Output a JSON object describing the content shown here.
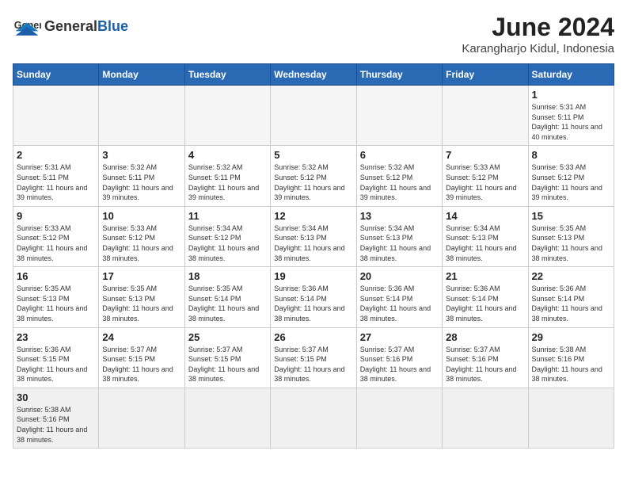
{
  "header": {
    "logo_general": "General",
    "logo_blue": "Blue",
    "month_title": "June 2024",
    "location": "Karangharjo Kidul, Indonesia"
  },
  "days_of_week": [
    "Sunday",
    "Monday",
    "Tuesday",
    "Wednesday",
    "Thursday",
    "Friday",
    "Saturday"
  ],
  "weeks": [
    [
      {
        "day": "",
        "info": ""
      },
      {
        "day": "",
        "info": ""
      },
      {
        "day": "",
        "info": ""
      },
      {
        "day": "",
        "info": ""
      },
      {
        "day": "",
        "info": ""
      },
      {
        "day": "",
        "info": ""
      },
      {
        "day": "1",
        "info": "Sunrise: 5:31 AM\nSunset: 5:11 PM\nDaylight: 11 hours and 40 minutes."
      }
    ],
    [
      {
        "day": "2",
        "info": "Sunrise: 5:31 AM\nSunset: 5:11 PM\nDaylight: 11 hours and 39 minutes."
      },
      {
        "day": "3",
        "info": "Sunrise: 5:32 AM\nSunset: 5:11 PM\nDaylight: 11 hours and 39 minutes."
      },
      {
        "day": "4",
        "info": "Sunrise: 5:32 AM\nSunset: 5:11 PM\nDaylight: 11 hours and 39 minutes."
      },
      {
        "day": "5",
        "info": "Sunrise: 5:32 AM\nSunset: 5:12 PM\nDaylight: 11 hours and 39 minutes."
      },
      {
        "day": "6",
        "info": "Sunrise: 5:32 AM\nSunset: 5:12 PM\nDaylight: 11 hours and 39 minutes."
      },
      {
        "day": "7",
        "info": "Sunrise: 5:33 AM\nSunset: 5:12 PM\nDaylight: 11 hours and 39 minutes."
      },
      {
        "day": "8",
        "info": "Sunrise: 5:33 AM\nSunset: 5:12 PM\nDaylight: 11 hours and 39 minutes."
      }
    ],
    [
      {
        "day": "9",
        "info": "Sunrise: 5:33 AM\nSunset: 5:12 PM\nDaylight: 11 hours and 38 minutes."
      },
      {
        "day": "10",
        "info": "Sunrise: 5:33 AM\nSunset: 5:12 PM\nDaylight: 11 hours and 38 minutes."
      },
      {
        "day": "11",
        "info": "Sunrise: 5:34 AM\nSunset: 5:12 PM\nDaylight: 11 hours and 38 minutes."
      },
      {
        "day": "12",
        "info": "Sunrise: 5:34 AM\nSunset: 5:13 PM\nDaylight: 11 hours and 38 minutes."
      },
      {
        "day": "13",
        "info": "Sunrise: 5:34 AM\nSunset: 5:13 PM\nDaylight: 11 hours and 38 minutes."
      },
      {
        "day": "14",
        "info": "Sunrise: 5:34 AM\nSunset: 5:13 PM\nDaylight: 11 hours and 38 minutes."
      },
      {
        "day": "15",
        "info": "Sunrise: 5:35 AM\nSunset: 5:13 PM\nDaylight: 11 hours and 38 minutes."
      }
    ],
    [
      {
        "day": "16",
        "info": "Sunrise: 5:35 AM\nSunset: 5:13 PM\nDaylight: 11 hours and 38 minutes."
      },
      {
        "day": "17",
        "info": "Sunrise: 5:35 AM\nSunset: 5:13 PM\nDaylight: 11 hours and 38 minutes."
      },
      {
        "day": "18",
        "info": "Sunrise: 5:35 AM\nSunset: 5:14 PM\nDaylight: 11 hours and 38 minutes."
      },
      {
        "day": "19",
        "info": "Sunrise: 5:36 AM\nSunset: 5:14 PM\nDaylight: 11 hours and 38 minutes."
      },
      {
        "day": "20",
        "info": "Sunrise: 5:36 AM\nSunset: 5:14 PM\nDaylight: 11 hours and 38 minutes."
      },
      {
        "day": "21",
        "info": "Sunrise: 5:36 AM\nSunset: 5:14 PM\nDaylight: 11 hours and 38 minutes."
      },
      {
        "day": "22",
        "info": "Sunrise: 5:36 AM\nSunset: 5:14 PM\nDaylight: 11 hours and 38 minutes."
      }
    ],
    [
      {
        "day": "23",
        "info": "Sunrise: 5:36 AM\nSunset: 5:15 PM\nDaylight: 11 hours and 38 minutes."
      },
      {
        "day": "24",
        "info": "Sunrise: 5:37 AM\nSunset: 5:15 PM\nDaylight: 11 hours and 38 minutes."
      },
      {
        "day": "25",
        "info": "Sunrise: 5:37 AM\nSunset: 5:15 PM\nDaylight: 11 hours and 38 minutes."
      },
      {
        "day": "26",
        "info": "Sunrise: 5:37 AM\nSunset: 5:15 PM\nDaylight: 11 hours and 38 minutes."
      },
      {
        "day": "27",
        "info": "Sunrise: 5:37 AM\nSunset: 5:16 PM\nDaylight: 11 hours and 38 minutes."
      },
      {
        "day": "28",
        "info": "Sunrise: 5:37 AM\nSunset: 5:16 PM\nDaylight: 11 hours and 38 minutes."
      },
      {
        "day": "29",
        "info": "Sunrise: 5:38 AM\nSunset: 5:16 PM\nDaylight: 11 hours and 38 minutes."
      }
    ],
    [
      {
        "day": "30",
        "info": "Sunrise: 5:38 AM\nSunset: 5:16 PM\nDaylight: 11 hours and 38 minutes."
      },
      {
        "day": "",
        "info": ""
      },
      {
        "day": "",
        "info": ""
      },
      {
        "day": "",
        "info": ""
      },
      {
        "day": "",
        "info": ""
      },
      {
        "day": "",
        "info": ""
      },
      {
        "day": "",
        "info": ""
      }
    ]
  ]
}
